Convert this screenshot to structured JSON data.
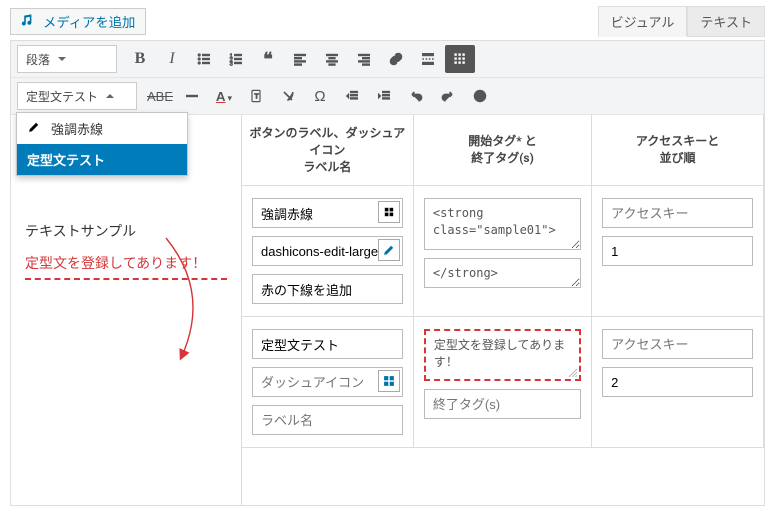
{
  "add_media_label": "メディアを追加",
  "tabs": {
    "visual": "ビジュアル",
    "text": "テキスト"
  },
  "block_select": "段落",
  "formats_select": "定型文テスト",
  "formats_menu": {
    "item1": "強調赤線",
    "item2": "定型文テスト"
  },
  "preview": {
    "p1": "テキストサンプル",
    "p2": "定型文を登録してあります！"
  },
  "headers": {
    "col1": "ボタンのラベル、ダッシュアイコン\nラベル名",
    "col2": "開始タグ* と\n終了タグ(s)",
    "col3": "アクセスキーと\n並び順"
  },
  "row1": {
    "label": "強調赤線",
    "icon": "dashicons-edit-large",
    "name": "赤の下線を追加",
    "open": "<strong class=\"sample01\">",
    "close": "</strong>",
    "accesskey_placeholder": "アクセスキー",
    "order": "1"
  },
  "row2": {
    "label": "定型文テスト",
    "icon_placeholder": "ダッシュアイコン",
    "name_placeholder": "ラベル名",
    "open": "定型文を登録してあります！",
    "close_placeholder": "終了タグ(s)",
    "accesskey_placeholder": "アクセスキー",
    "order": "2"
  }
}
